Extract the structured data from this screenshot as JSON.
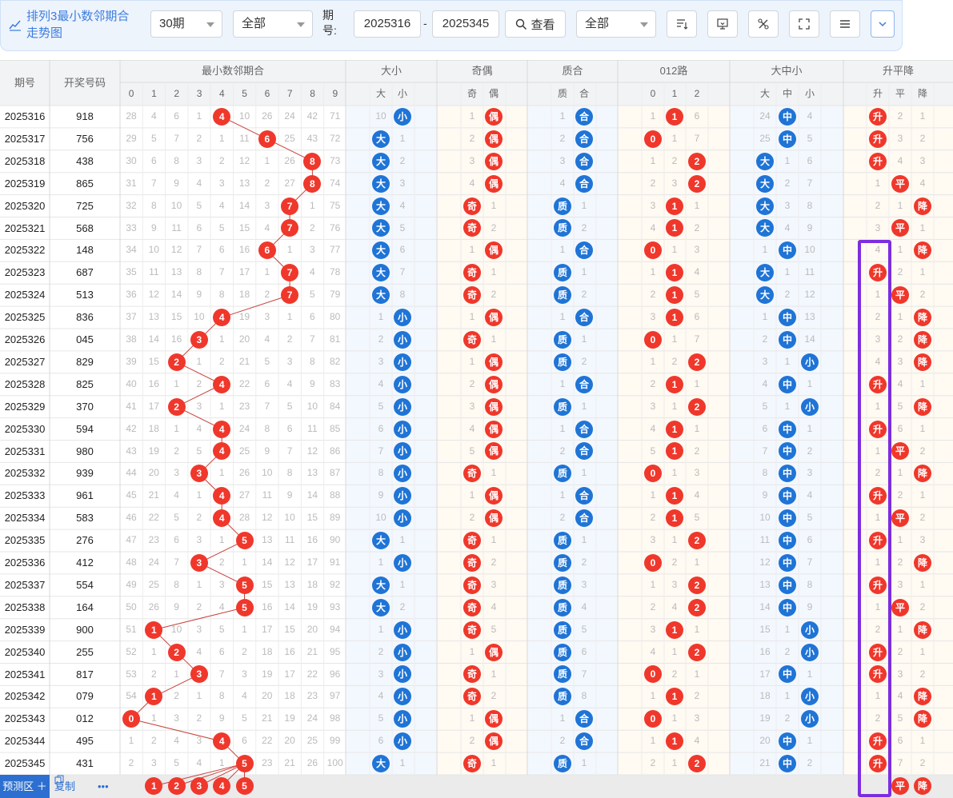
{
  "app": {
    "title_line1": "排列3最小数邻期合",
    "title_line2": "走势图"
  },
  "toolbar": {
    "periods": "30期",
    "filter1": "全部",
    "issue_label_line1": "期",
    "issue_label_line2": "号:",
    "from_issue": "2025316",
    "separator": "-",
    "to_issue": "2025345",
    "view_label": "查看",
    "filter2": "全部"
  },
  "headers": {
    "issue": "期号",
    "number": "开奖号码",
    "min_sum": "最小数邻期合",
    "big_small": "大小",
    "odd_even": "奇偶",
    "prime": "质合",
    "route012": "012路",
    "bms": "大中小",
    "updown": "升平降"
  },
  "subheaders": {
    "digits": [
      "0",
      "1",
      "2",
      "3",
      "4",
      "5",
      "6",
      "7",
      "8",
      "9"
    ],
    "bs": [
      "大",
      "小"
    ],
    "oe": [
      "奇",
      "偶"
    ],
    "pc": [
      "质",
      "合"
    ],
    "r012": [
      "0",
      "1",
      "2"
    ],
    "bms": [
      "大",
      "中",
      "小"
    ],
    "ud": [
      "升",
      "平",
      "降"
    ]
  },
  "rows": [
    {
      "issue": "2025316",
      "num": "918",
      "m": [
        28,
        4,
        6,
        1,
        4,
        10,
        26,
        24,
        42,
        71
      ],
      "mv": 4,
      "bs": [
        10,
        "小"
      ],
      "oe": [
        1,
        "偶"
      ],
      "pc": [
        1,
        "合"
      ],
      "r": [
        1,
        1,
        6
      ],
      "rv": 1,
      "bms": [
        24,
        "中",
        4
      ],
      "bmsv": 1,
      "ud": [
        "升",
        2,
        1
      ],
      "udv": 0
    },
    {
      "issue": "2025317",
      "num": "756",
      "m": [
        29,
        5,
        7,
        2,
        1,
        11,
        6,
        25,
        43,
        72
      ],
      "mv": 6,
      "bs": [
        "大",
        1
      ],
      "oe": [
        2,
        "偶"
      ],
      "pc": [
        2,
        "合"
      ],
      "r": [
        0,
        1,
        7
      ],
      "rv": 0,
      "bms": [
        25,
        "中",
        5
      ],
      "bmsv": 1,
      "ud": [
        "升",
        3,
        2
      ],
      "udv": 0
    },
    {
      "issue": "2025318",
      "num": "438",
      "m": [
        30,
        6,
        8,
        3,
        2,
        12,
        1,
        26,
        8,
        73
      ],
      "mv": 8,
      "bs": [
        "大",
        2
      ],
      "oe": [
        3,
        "偶"
      ],
      "pc": [
        3,
        "合"
      ],
      "r": [
        1,
        2,
        2
      ],
      "rv": 2,
      "bms": [
        "大",
        1,
        6
      ],
      "bmsv": 0,
      "ud": [
        "升",
        4,
        3
      ],
      "udv": 0
    },
    {
      "issue": "2025319",
      "num": "865",
      "m": [
        31,
        7,
        9,
        4,
        3,
        13,
        2,
        27,
        8,
        74
      ],
      "mv": 8,
      "bs": [
        "大",
        3
      ],
      "oe": [
        4,
        "偶"
      ],
      "pc": [
        4,
        "合"
      ],
      "r": [
        2,
        3,
        2
      ],
      "rv": 2,
      "bms": [
        "大",
        2,
        7
      ],
      "bmsv": 0,
      "ud": [
        1,
        "平",
        4
      ],
      "udv": 1
    },
    {
      "issue": "2025320",
      "num": "725",
      "m": [
        32,
        8,
        10,
        5,
        4,
        14,
        3,
        7,
        1,
        75
      ],
      "mv": 7,
      "bs": [
        "大",
        4
      ],
      "oe": [
        "奇",
        1
      ],
      "pc": [
        "质",
        1
      ],
      "r": [
        3,
        1,
        1
      ],
      "rv": 1,
      "bms": [
        "大",
        3,
        8
      ],
      "bmsv": 0,
      "ud": [
        2,
        1,
        "降"
      ],
      "udv": 2
    },
    {
      "issue": "2025321",
      "num": "568",
      "m": [
        33,
        9,
        11,
        6,
        5,
        15,
        4,
        7,
        2,
        76
      ],
      "mv": 7,
      "bs": [
        "大",
        5
      ],
      "oe": [
        "奇",
        2
      ],
      "pc": [
        "质",
        2
      ],
      "r": [
        4,
        1,
        2
      ],
      "rv": 1,
      "bms": [
        "大",
        4,
        9
      ],
      "bmsv": 0,
      "ud": [
        3,
        "平",
        1
      ],
      "udv": 1
    },
    {
      "issue": "2025322",
      "num": "148",
      "m": [
        34,
        10,
        12,
        7,
        6,
        16,
        6,
        1,
        3,
        77
      ],
      "mv": 6,
      "bs": [
        "大",
        6
      ],
      "oe": [
        1,
        "偶"
      ],
      "pc": [
        1,
        "合"
      ],
      "r": [
        0,
        1,
        3
      ],
      "rv": 0,
      "bms": [
        1,
        "中",
        10
      ],
      "bmsv": 1,
      "ud": [
        4,
        1,
        "降"
      ],
      "udv": 2
    },
    {
      "issue": "2025323",
      "num": "687",
      "m": [
        35,
        11,
        13,
        8,
        7,
        17,
        1,
        7,
        4,
        78
      ],
      "mv": 7,
      "bs": [
        "大",
        7
      ],
      "oe": [
        "奇",
        1
      ],
      "pc": [
        "质",
        1
      ],
      "r": [
        1,
        1,
        4
      ],
      "rv": 1,
      "bms": [
        "大",
        1,
        11
      ],
      "bmsv": 0,
      "ud": [
        "升",
        2,
        1
      ],
      "udv": 0
    },
    {
      "issue": "2025324",
      "num": "513",
      "m": [
        36,
        12,
        14,
        9,
        8,
        18,
        2,
        7,
        5,
        79
      ],
      "mv": 7,
      "bs": [
        "大",
        8
      ],
      "oe": [
        "奇",
        2
      ],
      "pc": [
        "质",
        2
      ],
      "r": [
        2,
        1,
        5
      ],
      "rv": 1,
      "bms": [
        "大",
        2,
        12
      ],
      "bmsv": 0,
      "ud": [
        1,
        "平",
        2
      ],
      "udv": 1
    },
    {
      "issue": "2025325",
      "num": "836",
      "m": [
        37,
        13,
        15,
        10,
        4,
        19,
        3,
        1,
        6,
        80
      ],
      "mv": 4,
      "bs": [
        1,
        "小"
      ],
      "oe": [
        1,
        "偶"
      ],
      "pc": [
        1,
        "合"
      ],
      "r": [
        3,
        1,
        6
      ],
      "rv": 1,
      "bms": [
        1,
        "中",
        13
      ],
      "bmsv": 1,
      "ud": [
        2,
        1,
        "降"
      ],
      "udv": 2
    },
    {
      "issue": "2025326",
      "num": "045",
      "m": [
        38,
        14,
        16,
        3,
        1,
        20,
        4,
        2,
        7,
        81
      ],
      "mv": 3,
      "bs": [
        2,
        "小"
      ],
      "oe": [
        "奇",
        1
      ],
      "pc": [
        "质",
        1
      ],
      "r": [
        0,
        1,
        7
      ],
      "rv": 0,
      "bms": [
        2,
        "中",
        14
      ],
      "bmsv": 1,
      "ud": [
        3,
        2,
        "降"
      ],
      "udv": 2
    },
    {
      "issue": "2025327",
      "num": "829",
      "m": [
        39,
        15,
        2,
        1,
        2,
        21,
        5,
        3,
        8,
        82
      ],
      "mv": 2,
      "bs": [
        3,
        "小"
      ],
      "oe": [
        1,
        "偶"
      ],
      "pc": [
        "质",
        2
      ],
      "r": [
        1,
        2,
        2
      ],
      "rv": 2,
      "bms": [
        3,
        1,
        "小"
      ],
      "bmsv": 2,
      "ud": [
        4,
        3,
        "降"
      ],
      "udv": 2
    },
    {
      "issue": "2025328",
      "num": "825",
      "m": [
        40,
        16,
        1,
        2,
        4,
        22,
        6,
        4,
        9,
        83
      ],
      "mv": 4,
      "bs": [
        4,
        "小"
      ],
      "oe": [
        2,
        "偶"
      ],
      "pc": [
        1,
        "合"
      ],
      "r": [
        2,
        1,
        1
      ],
      "rv": 1,
      "bms": [
        4,
        "中",
        1
      ],
      "bmsv": 1,
      "ud": [
        "升",
        4,
        1
      ],
      "udv": 0
    },
    {
      "issue": "2025329",
      "num": "370",
      "m": [
        41,
        17,
        2,
        3,
        1,
        23,
        7,
        5,
        10,
        84
      ],
      "mv": 2,
      "bs": [
        5,
        "小"
      ],
      "oe": [
        3,
        "偶"
      ],
      "pc": [
        "质",
        1
      ],
      "r": [
        3,
        1,
        2
      ],
      "rv": 2,
      "bms": [
        5,
        1,
        "小"
      ],
      "bmsv": 2,
      "ud": [
        1,
        5,
        "降"
      ],
      "udv": 2
    },
    {
      "issue": "2025330",
      "num": "594",
      "m": [
        42,
        18,
        1,
        4,
        4,
        24,
        8,
        6,
        11,
        85
      ],
      "mv": 4,
      "bs": [
        6,
        "小"
      ],
      "oe": [
        4,
        "偶"
      ],
      "pc": [
        1,
        "合"
      ],
      "r": [
        4,
        1,
        1
      ],
      "rv": 1,
      "bms": [
        6,
        "中",
        1
      ],
      "bmsv": 1,
      "ud": [
        "升",
        6,
        1
      ],
      "udv": 0
    },
    {
      "issue": "2025331",
      "num": "980",
      "m": [
        43,
        19,
        2,
        5,
        4,
        25,
        9,
        7,
        12,
        86
      ],
      "mv": 4,
      "bs": [
        7,
        "小"
      ],
      "oe": [
        5,
        "偶"
      ],
      "pc": [
        2,
        "合"
      ],
      "r": [
        5,
        1,
        2
      ],
      "rv": 1,
      "bms": [
        7,
        "中",
        2
      ],
      "bmsv": 1,
      "ud": [
        1,
        "平",
        2
      ],
      "udv": 1
    },
    {
      "issue": "2025332",
      "num": "939",
      "m": [
        44,
        20,
        3,
        3,
        1,
        26,
        10,
        8,
        13,
        87
      ],
      "mv": 3,
      "bs": [
        8,
        "小"
      ],
      "oe": [
        "奇",
        1
      ],
      "pc": [
        "质",
        1
      ],
      "r": [
        0,
        1,
        3
      ],
      "rv": 0,
      "bms": [
        8,
        "中",
        3
      ],
      "bmsv": 1,
      "ud": [
        2,
        1,
        "降"
      ],
      "udv": 2
    },
    {
      "issue": "2025333",
      "num": "961",
      "m": [
        45,
        21,
        4,
        1,
        4,
        27,
        11,
        9,
        14,
        88
      ],
      "mv": 4,
      "bs": [
        9,
        "小"
      ],
      "oe": [
        1,
        "偶"
      ],
      "pc": [
        1,
        "合"
      ],
      "r": [
        1,
        1,
        4
      ],
      "rv": 1,
      "bms": [
        9,
        "中",
        4
      ],
      "bmsv": 1,
      "ud": [
        "升",
        2,
        1
      ],
      "udv": 0
    },
    {
      "issue": "2025334",
      "num": "583",
      "m": [
        46,
        22,
        5,
        2,
        4,
        28,
        12,
        10,
        15,
        89
      ],
      "mv": 4,
      "bs": [
        10,
        "小"
      ],
      "oe": [
        2,
        "偶"
      ],
      "pc": [
        2,
        "合"
      ],
      "r": [
        2,
        1,
        5
      ],
      "rv": 1,
      "bms": [
        10,
        "中",
        5
      ],
      "bmsv": 1,
      "ud": [
        1,
        "平",
        2
      ],
      "udv": 1
    },
    {
      "issue": "2025335",
      "num": "276",
      "m": [
        47,
        23,
        6,
        3,
        1,
        5,
        13,
        11,
        16,
        90
      ],
      "mv": 5,
      "bs": [
        "大",
        1
      ],
      "oe": [
        "奇",
        1
      ],
      "pc": [
        "质",
        1
      ],
      "r": [
        3,
        1,
        2
      ],
      "rv": 2,
      "bms": [
        11,
        "中",
        6
      ],
      "bmsv": 1,
      "ud": [
        "升",
        1,
        3
      ],
      "udv": 0
    },
    {
      "issue": "2025336",
      "num": "412",
      "m": [
        48,
        24,
        7,
        3,
        2,
        1,
        14,
        12,
        17,
        91
      ],
      "mv": 3,
      "bs": [
        1,
        "小"
      ],
      "oe": [
        "奇",
        2
      ],
      "pc": [
        "质",
        2
      ],
      "r": [
        0,
        2,
        1
      ],
      "rv": 0,
      "bms": [
        12,
        "中",
        7
      ],
      "bmsv": 1,
      "ud": [
        1,
        2,
        "降"
      ],
      "udv": 2
    },
    {
      "issue": "2025337",
      "num": "554",
      "m": [
        49,
        25,
        8,
        1,
        3,
        5,
        15,
        13,
        18,
        92
      ],
      "mv": 5,
      "bs": [
        "大",
        1
      ],
      "oe": [
        "奇",
        3
      ],
      "pc": [
        "质",
        3
      ],
      "r": [
        1,
        3,
        2
      ],
      "rv": 2,
      "bms": [
        13,
        "中",
        8
      ],
      "bmsv": 1,
      "ud": [
        "升",
        3,
        1
      ],
      "udv": 0
    },
    {
      "issue": "2025338",
      "num": "164",
      "m": [
        50,
        26,
        9,
        2,
        4,
        5,
        16,
        14,
        19,
        93
      ],
      "mv": 5,
      "bs": [
        "大",
        2
      ],
      "oe": [
        "奇",
        4
      ],
      "pc": [
        "质",
        4
      ],
      "r": [
        2,
        4,
        2
      ],
      "rv": 2,
      "bms": [
        14,
        "中",
        9
      ],
      "bmsv": 1,
      "ud": [
        1,
        "平",
        2
      ],
      "udv": 1
    },
    {
      "issue": "2025339",
      "num": "900",
      "m": [
        51,
        1,
        10,
        3,
        5,
        1,
        17,
        15,
        20,
        94
      ],
      "mv": 1,
      "bs": [
        1,
        "小"
      ],
      "oe": [
        "奇",
        5
      ],
      "pc": [
        "质",
        5
      ],
      "r": [
        3,
        1,
        1
      ],
      "rv": 1,
      "bms": [
        15,
        1,
        "小"
      ],
      "bmsv": 2,
      "ud": [
        2,
        1,
        "降"
      ],
      "udv": 2
    },
    {
      "issue": "2025340",
      "num": "255",
      "m": [
        52,
        1,
        2,
        4,
        6,
        2,
        18,
        16,
        21,
        95
      ],
      "mv": 2,
      "bs": [
        2,
        "小"
      ],
      "oe": [
        1,
        "偶"
      ],
      "pc": [
        "质",
        6
      ],
      "r": [
        4,
        1,
        2
      ],
      "rv": 2,
      "bms": [
        16,
        2,
        "小"
      ],
      "bmsv": 2,
      "ud": [
        "升",
        2,
        1
      ],
      "udv": 0
    },
    {
      "issue": "2025341",
      "num": "817",
      "m": [
        53,
        2,
        1,
        3,
        7,
        3,
        19,
        17,
        22,
        96
      ],
      "mv": 3,
      "bs": [
        3,
        "小"
      ],
      "oe": [
        "奇",
        1
      ],
      "pc": [
        "质",
        7
      ],
      "r": [
        0,
        2,
        1
      ],
      "rv": 0,
      "bms": [
        17,
        "中",
        1
      ],
      "bmsv": 1,
      "ud": [
        "升",
        3,
        2
      ],
      "udv": 0
    },
    {
      "issue": "2025342",
      "num": "079",
      "m": [
        54,
        1,
        2,
        1,
        8,
        4,
        20,
        18,
        23,
        97
      ],
      "mv": 1,
      "bs": [
        4,
        "小"
      ],
      "oe": [
        "奇",
        2
      ],
      "pc": [
        "质",
        8
      ],
      "r": [
        1,
        1,
        2
      ],
      "rv": 1,
      "bms": [
        18,
        1,
        "小"
      ],
      "bmsv": 2,
      "ud": [
        1,
        4,
        "降"
      ],
      "udv": 2
    },
    {
      "issue": "2025343",
      "num": "012",
      "m": [
        0,
        1,
        3,
        2,
        9,
        5,
        21,
        19,
        24,
        98
      ],
      "mv": 0,
      "bs": [
        5,
        "小"
      ],
      "oe": [
        1,
        "偶"
      ],
      "pc": [
        1,
        "合"
      ],
      "r": [
        0,
        1,
        3
      ],
      "rv": 0,
      "bms": [
        19,
        2,
        "小"
      ],
      "bmsv": 2,
      "ud": [
        2,
        5,
        "降"
      ],
      "udv": 2
    },
    {
      "issue": "2025344",
      "num": "495",
      "m": [
        1,
        2,
        4,
        3,
        4,
        6,
        22,
        20,
        25,
        99
      ],
      "mv": 4,
      "bs": [
        6,
        "小"
      ],
      "oe": [
        2,
        "偶"
      ],
      "pc": [
        2,
        "合"
      ],
      "r": [
        1,
        1,
        4
      ],
      "rv": 1,
      "bms": [
        20,
        "中",
        1
      ],
      "bmsv": 1,
      "ud": [
        "升",
        6,
        1
      ],
      "udv": 0
    },
    {
      "issue": "2025345",
      "num": "431",
      "m": [
        2,
        3,
        5,
        4,
        1,
        5,
        23,
        21,
        26,
        100
      ],
      "mv": 5,
      "bs": [
        "大",
        1
      ],
      "oe": [
        "奇",
        1
      ],
      "pc": [
        "质",
        1
      ],
      "r": [
        2,
        1,
        2
      ],
      "rv": 2,
      "bms": [
        21,
        "中",
        2
      ],
      "bmsv": 1,
      "ud": [
        "升",
        7,
        2
      ],
      "udv": 0
    }
  ],
  "bottom": {
    "predict": "预测区 ＋",
    "copy": "复制",
    "more": "•••",
    "pred_digits": [
      "1",
      "2",
      "3",
      "4",
      "5"
    ],
    "pred_flat": "平",
    "pred_down": "降"
  },
  "colors": {
    "red": "#f0372b",
    "blue": "#1f74d6",
    "accent": "#3b7de0",
    "highlight": "#7d2ee0"
  }
}
